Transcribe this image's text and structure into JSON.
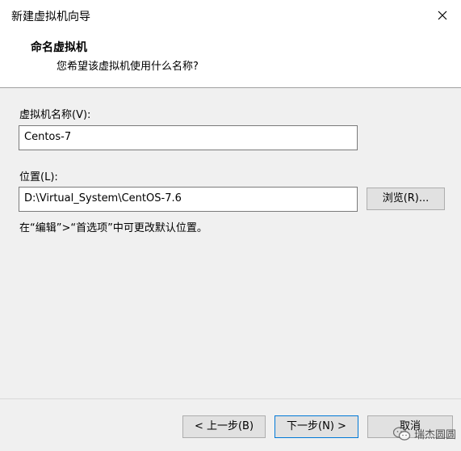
{
  "window": {
    "title": "新建虚拟机向导"
  },
  "header": {
    "title": "命名虚拟机",
    "subtitle": "您希望该虚拟机使用什么名称?"
  },
  "form": {
    "name_label": "虚拟机名称(V):",
    "name_value": "Centos-7",
    "location_label": "位置(L):",
    "location_value": "D:\\Virtual_System\\CentOS-7.6",
    "browse_label": "浏览(R)...",
    "hint": "在“编辑”>“首选项”中可更改默认位置。"
  },
  "footer": {
    "back_label": "< 上一步(B)",
    "next_label": "下一步(N) >",
    "cancel_label": "取消"
  },
  "watermark": {
    "text": "瑞杰圆圆",
    "icon": "wechat-icon"
  },
  "colors": {
    "focus_border": "#0078d7",
    "dialog_bg": "#f0f0f0"
  }
}
